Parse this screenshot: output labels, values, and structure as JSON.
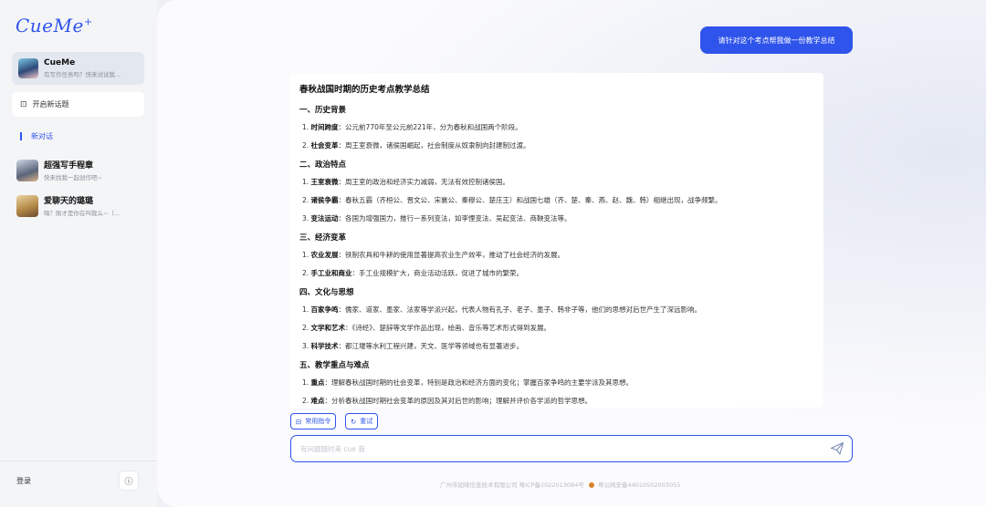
{
  "sidebar": {
    "logo": "CueMe",
    "logo_mark": "+",
    "assistant": {
      "name": "CueMe",
      "subtitle": "有写作任务吗？快来试试我..."
    },
    "new_topic_label": "开启新话题",
    "new_chat_label": "新对话",
    "conversations": [
      {
        "name": "超强写手程章",
        "preview": "快来找我一起创作吧~"
      },
      {
        "name": "爱聊天的璐璐",
        "preview": "嗨？刚才是你在叫我么~（..."
      }
    ],
    "login_label": "登录",
    "info_icon": "ⓘ"
  },
  "chat": {
    "user_message": "请针对这个考点帮我做一份教学总结",
    "answer_title": "春秋战国时期的历史考点教学总结",
    "sections": [
      {
        "title": "一、历史背景",
        "items": [
          {
            "num": "1.",
            "term": "时间跨度",
            "text": "：公元前770年至公元前221年，分为春秋和战国两个阶段。"
          },
          {
            "num": "2.",
            "term": "社会变革",
            "text": "：周王室衰微，诸侯国崛起，社会制度从奴隶制向封建制过渡。"
          }
        ]
      },
      {
        "title": "二、政治特点",
        "items": [
          {
            "num": "1.",
            "term": "王室衰微",
            "text": "：周王室的政治和经济实力减弱，无法有效控制诸侯国。"
          },
          {
            "num": "2.",
            "term": "诸侯争霸",
            "text": "：春秋五霸（齐桓公、晋文公、宋襄公、秦穆公、楚庄王）和战国七雄（齐、楚、秦、燕、赵、魏、韩）相继出现，战争频繁。"
          },
          {
            "num": "3.",
            "term": "变法运动",
            "text": "：各国为增强国力，推行一系列变法，如李悝变法、吴起变法、商鞅变法等。"
          }
        ]
      },
      {
        "title": "三、经济变革",
        "items": [
          {
            "num": "1.",
            "term": "农业发展",
            "text": "：铁制农具和牛耕的使用显著提高农业生产效率，推动了社会经济的发展。"
          },
          {
            "num": "2.",
            "term": "手工业和商业",
            "text": "：手工业规模扩大，商业活动活跃，促进了城市的繁荣。"
          }
        ]
      },
      {
        "title": "四、文化与思想",
        "items": [
          {
            "num": "1.",
            "term": "百家争鸣",
            "text": "：儒家、道家、墨家、法家等学派兴起，代表人物有孔子、老子、墨子、韩非子等，他们的思想对后世产生了深远影响。"
          },
          {
            "num": "2.",
            "term": "文学和艺术",
            "text": "：《诗经》、楚辞等文学作品出现，绘画、音乐等艺术形式得到发展。"
          },
          {
            "num": "3.",
            "term": "科学技术",
            "text": "：都江堰等水利工程兴建，天文、医学等领域也有显著进步。"
          }
        ]
      },
      {
        "title": "五、教学重点与难点",
        "items": [
          {
            "num": "1.",
            "term": "重点",
            "text": "：理解春秋战国时期的社会变革，特别是政治和经济方面的变化；掌握百家争鸣的主要学派及其思想。"
          },
          {
            "num": "2.",
            "term": "难点",
            "text": "：分析春秋战国时期社会变革的原因及其对后世的影响；理解并评价各学派的哲学思想。"
          }
        ]
      }
    ],
    "chips": {
      "common_commands": "常用指令",
      "retry": "重试"
    },
    "input_placeholder": "有问题随时来 cue 我",
    "footer_company": "广州市如晓信息技术有限公司 粤ICP备2022013084号",
    "footer_police": "粤公网安备44010502003055"
  },
  "colors": {
    "accent": "#2f54eb"
  }
}
